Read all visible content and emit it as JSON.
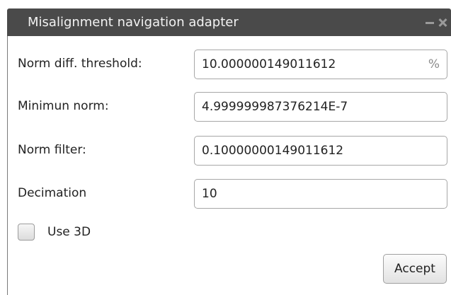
{
  "window": {
    "title": "Misalignment navigation adapter"
  },
  "fields": [
    {
      "label": "Norm diff. threshold:",
      "value": "10.000000149011612",
      "unit": "%"
    },
    {
      "label": "Minimun norm:",
      "value": "4.999999987376214E-7"
    },
    {
      "label": "Norm filter:",
      "value": "0.10000000149011612"
    },
    {
      "label": "Decimation",
      "value": "10"
    }
  ],
  "use3d": {
    "label": "Use 3D",
    "checked": false
  },
  "actions": {
    "accept_label": "Accept"
  },
  "icons": {
    "minimize": "minimize-icon",
    "close": "close-icon"
  }
}
